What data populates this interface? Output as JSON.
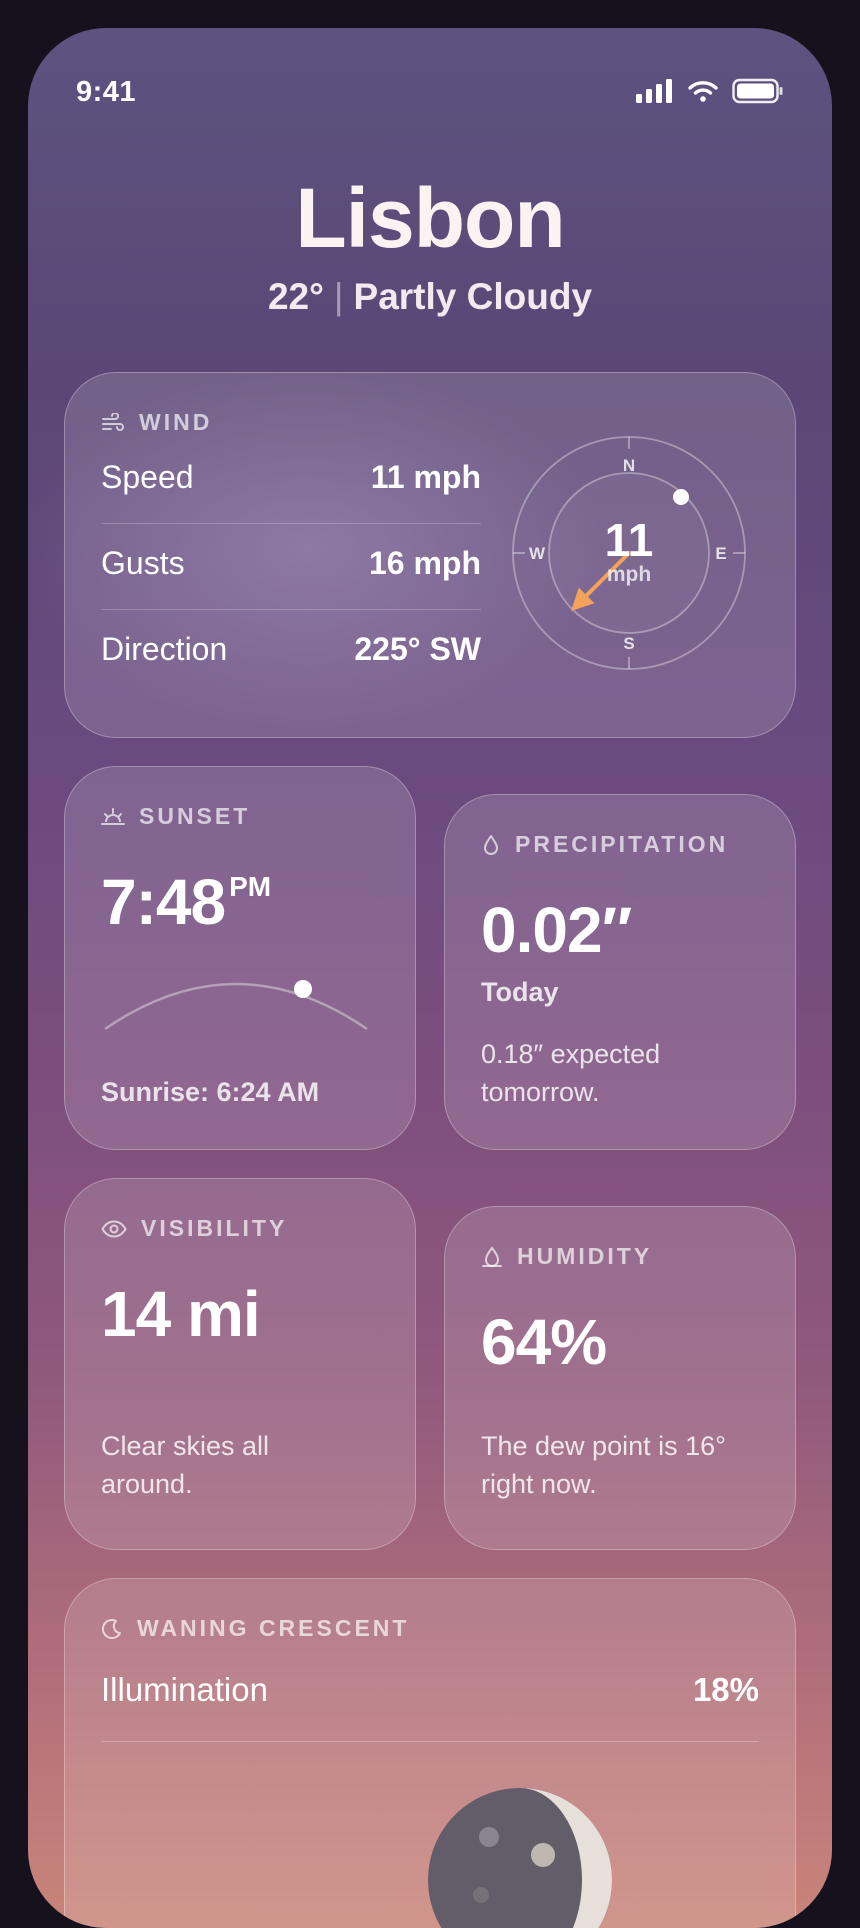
{
  "status": {
    "time": "9:41"
  },
  "location": {
    "city": "Lisbon",
    "temperature": "22°",
    "condition": "Partly Cloudy"
  },
  "wind": {
    "title": "WIND",
    "rows": [
      {
        "label": "Speed",
        "value": "11 mph"
      },
      {
        "label": "Gusts",
        "value": "16 mph"
      },
      {
        "label": "Direction",
        "value": "225° SW"
      }
    ],
    "compass": {
      "speed": "11",
      "unit": "mph",
      "n": "N",
      "e": "E",
      "s": "S",
      "w": "W",
      "direction_deg": 225,
      "arrow_color": "#f5a25a"
    }
  },
  "sunset": {
    "title": "SUNSET",
    "time": "7:48",
    "ampm": "PM",
    "sunrise": "Sunrise: 6:24 AM"
  },
  "precipitation": {
    "title": "PRECIPITATION",
    "value": "0.02″",
    "period": "Today",
    "forecast": "0.18″ expected tomorrow."
  },
  "visibility": {
    "title": "VISIBILITY",
    "value": "14 mi",
    "note": "Clear skies all around."
  },
  "humidity": {
    "title": "HUMIDITY",
    "value": "64%",
    "note": "The dew point is 16° right now."
  },
  "moon": {
    "title": "WANING CRESCENT",
    "label": "Illumination",
    "value": "18%"
  }
}
